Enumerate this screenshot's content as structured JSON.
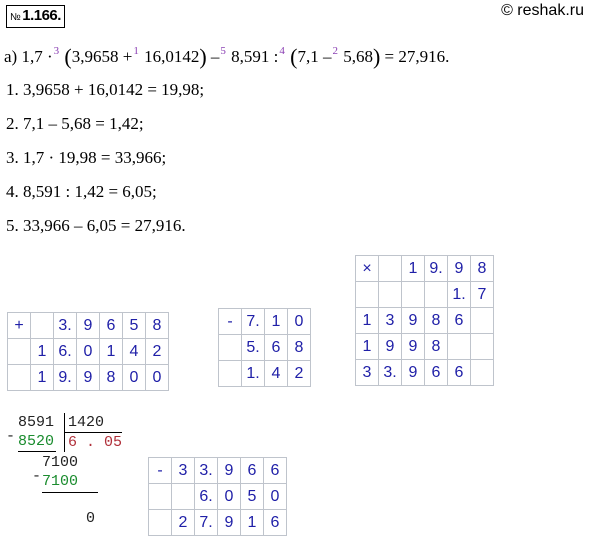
{
  "header": {
    "problem_prefix": "№",
    "problem_number": "1.166.",
    "site": "© reshak.ru"
  },
  "expression": {
    "label": "а)",
    "a": "1,7",
    "op_mul": "·",
    "o3": "3",
    "b": "3,9658 +",
    "o1": "1",
    "c": "16,0142",
    "minus": "–",
    "o5": "5",
    "d": "8,591 :",
    "o4": "4",
    "e": "7,1 –",
    "o2": "2",
    "f": "5,68",
    "result": "= 27,916."
  },
  "steps": [
    "1.  3,9658 + 16,0142 = 19,98;",
    "2.  7,1 – 5,68 = 1,42;",
    "3.  1,7 · 19,98 = 33,966;",
    "4.  8,591 : 1,42 = 6,05;",
    "5.  33,966 – 6,05 = 27,916."
  ],
  "add_table": {
    "op": "+",
    "rows": [
      [
        "",
        "",
        "3.",
        "9",
        "6",
        "5",
        "8"
      ],
      [
        "",
        "1",
        "6.",
        "0",
        "1",
        "4",
        "2"
      ],
      [
        "",
        "1",
        "9.",
        "9",
        "8",
        "0",
        "0"
      ]
    ]
  },
  "sub_table1": {
    "op": "-",
    "rows": [
      [
        "",
        "7.",
        "1",
        "0"
      ],
      [
        "",
        "5.",
        "6",
        "8"
      ],
      [
        "",
        "1.",
        "4",
        "2"
      ]
    ]
  },
  "mul_table": {
    "op": "×",
    "rows": [
      [
        "",
        "",
        "1",
        "9.",
        "9",
        "8"
      ],
      [
        "",
        "",
        "",
        "",
        "1.",
        "7"
      ],
      [
        "1",
        "3",
        "9",
        "8",
        "6",
        ""
      ],
      [
        "1",
        "9",
        "9",
        "8",
        "",
        ""
      ],
      [
        "3",
        "3.",
        "9",
        "6",
        "6",
        ""
      ]
    ]
  },
  "long_division": {
    "dividend": "8591",
    "divisor": "1420",
    "sub1": "8520",
    "quotient": "6 . 05",
    "rem1": "7100",
    "sub2": "7100",
    "final": "0",
    "minus": "-"
  },
  "sub_table2": {
    "op": "-",
    "rows": [
      [
        "",
        "3",
        "3.",
        "9",
        "6",
        "6"
      ],
      [
        "",
        "",
        "6.",
        "0",
        "5",
        "0"
      ],
      [
        "",
        "2",
        "7.",
        "9",
        "1",
        "6"
      ]
    ]
  }
}
